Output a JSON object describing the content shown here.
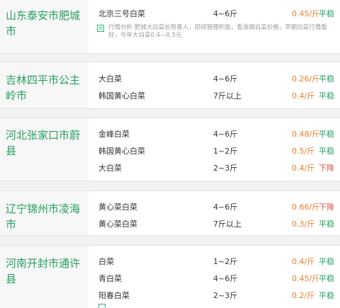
{
  "regions": [
    {
      "name": "山东泰安市肥城市",
      "rows": [
        {
          "variety": "北京三号白菜",
          "size": "4~6斤",
          "price": "0.45/斤",
          "trend": "平稳",
          "trend_dir": "flat"
        }
      ],
      "note": "行情分析 肥城大白菜长势喜人，田间管理积极，看涨期白菜价格，早期白菜行情看好，今年大白菜0.4—0.5元"
    },
    {
      "name": "吉林四平市公主岭市",
      "rows": [
        {
          "variety": "大白菜",
          "size": "4~6斤",
          "price": "0.26/斤",
          "trend": "平稳",
          "trend_dir": "flat"
        },
        {
          "variety": "韩国黄心白菜",
          "size": "7斤以上",
          "price": "0.4/斤",
          "trend": "平稳",
          "trend_dir": "flat"
        }
      ]
    },
    {
      "name": "河北张家口市蔚县",
      "rows": [
        {
          "variety": "金峰白菜",
          "size": "4~6斤",
          "price": "0.48/斤",
          "trend": "平稳",
          "trend_dir": "flat"
        },
        {
          "variety": "韩国黄心白菜",
          "size": "1~2斤",
          "price": "0.5/斤",
          "trend": "平稳",
          "trend_dir": "flat"
        },
        {
          "variety": "大白菜",
          "size": "2~3斤",
          "price": "0.4/斤",
          "trend": "下降",
          "trend_dir": "down"
        }
      ]
    },
    {
      "name": "辽宁锦州市凌海市",
      "rows": [
        {
          "variety": "黄心菜白菜",
          "size": "4~6斤",
          "price": "0.66/斤",
          "trend": "下降",
          "trend_dir": "down"
        },
        {
          "variety": "黄心菜白菜",
          "size": "7斤以上",
          "price": "0.3/斤",
          "trend": "平稳",
          "trend_dir": "flat"
        }
      ]
    },
    {
      "name": "河南开封市通许县",
      "rows": [
        {
          "variety": "白菜",
          "size": "1~2斤",
          "price": "0.4/斤",
          "trend": "平稳",
          "trend_dir": "flat"
        },
        {
          "variety": "青白菜",
          "size": "4~6斤",
          "price": "0.45/斤",
          "trend": "平稳",
          "trend_dir": "flat"
        },
        {
          "variety": "阳春白菜",
          "size": "2~3斤",
          "price": "0.2/斤",
          "trend": "平稳",
          "trend_dir": "flat"
        }
      ]
    }
  ],
  "colors": {
    "accent_green": "#25a061",
    "price_orange": "#f07c27",
    "down_red": "#e0533e"
  },
  "icons": {
    "note": "analysis-note-icon"
  }
}
